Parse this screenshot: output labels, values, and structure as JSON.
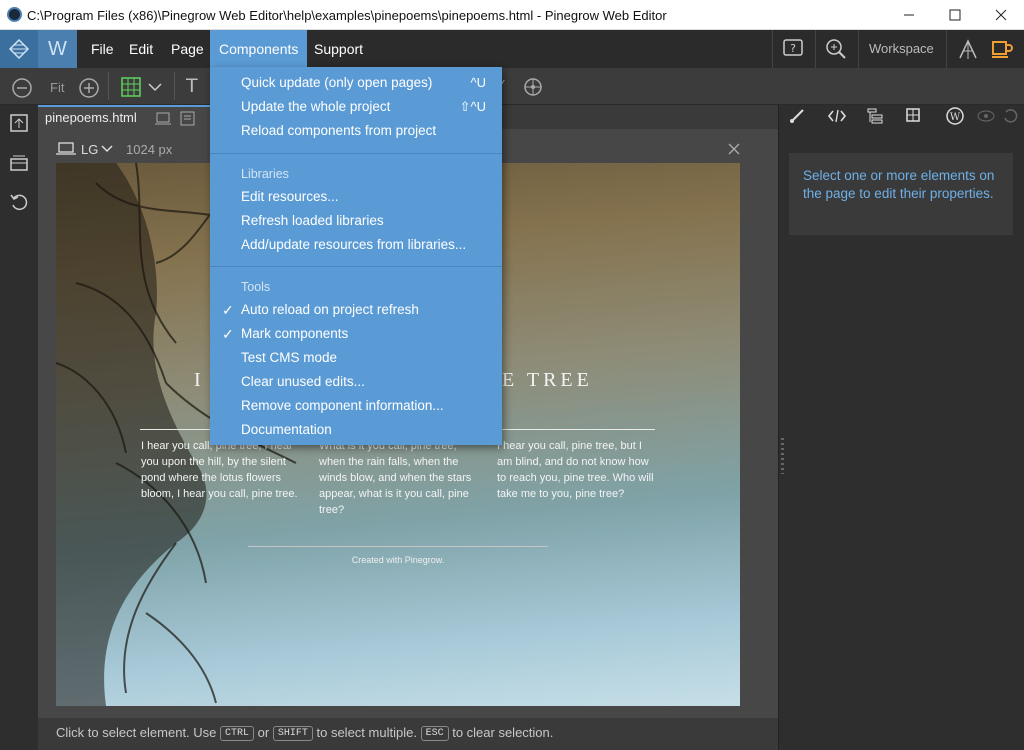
{
  "window": {
    "title": "C:\\Program Files (x86)\\Pinegrow Web Editor\\help\\examples\\pinepoems\\pinepoems.html - Pinegrow Web Editor"
  },
  "menubar": {
    "items": [
      "File",
      "Edit",
      "Page",
      "Components",
      "Support"
    ],
    "active": "Components",
    "workspace_label": "Workspace"
  },
  "toolbar": {
    "fit_label": "Fit"
  },
  "document": {
    "tab_label": "pinepoems.html",
    "device_label": "LG",
    "width_label": "1024 px"
  },
  "page": {
    "heading_left": "I",
    "heading_right": "E TREE",
    "poems": [
      "I hear you call, pine tree, I hear you upon the hill, by the silent pond where the lotus flowers bloom, I hear you call, pine tree.",
      "What is it you call, pine tree, when the rain falls, when the winds blow, and when the stars appear, what is it you call, pine tree?",
      "I hear you call, pine tree, but I am blind, and do not know how to reach you, pine tree. Who will take me to you, pine tree?"
    ],
    "footer": "Created with Pinegrow."
  },
  "dropdown": {
    "quick_update": "Quick update (only open pages)",
    "quick_update_shortcut": "^U",
    "update_project": "Update the whole project",
    "update_project_shortcut": "⇧^U",
    "reload_components": "Reload components from project",
    "libraries_header": "Libraries",
    "edit_resources": "Edit resources...",
    "refresh_libraries": "Refresh loaded libraries",
    "add_update_resources": "Add/update resources from libraries...",
    "tools_header": "Tools",
    "auto_reload": "Auto reload on project refresh",
    "mark_components": "Mark components",
    "test_cms": "Test CMS mode",
    "clear_unused": "Clear unused edits...",
    "remove_info": "Remove component information...",
    "documentation": "Documentation"
  },
  "right_panel": {
    "message": "Select one or more elements on the page to edit their properties."
  },
  "status": {
    "part1": "Click to select element. Use",
    "ctrl": "CTRL",
    "or": "or",
    "shift": "SHIFT",
    "part2": "to select multiple.",
    "esc": "ESC",
    "part3": "to clear selection."
  },
  "colors": {
    "accent": "#5b9bd5",
    "menubar_bg": "#2b2b2b",
    "panel_bg": "#2e2e2e",
    "orange_icon": "#f0a030",
    "info_text": "#6fb0e8"
  }
}
